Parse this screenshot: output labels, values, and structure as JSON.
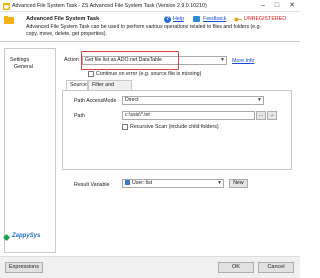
{
  "window": {
    "title": "Advanced File System Task - ZS Advanced File System Task (Version 2.9.0.10210)",
    "minimize_icon": "minimize-icon",
    "maximize_icon": "maximize-icon",
    "close_icon": "close-icon"
  },
  "header": {
    "title": "Advanced File System Task",
    "description": "Advanced File System Task can be used to perform various operations related to files and folders (e.g. copy, move, delete, get properties).",
    "help_label": "Help",
    "feedback_label": "Feedback",
    "unregistered_label": "UNREGISTERED"
  },
  "nav": {
    "items": [
      {
        "label": "Settings"
      },
      {
        "label": "General"
      }
    ],
    "logo_text": "ZappySys"
  },
  "form": {
    "action_label": "Action",
    "action_value": "Get file list as ADO.net DataTable",
    "more_info_label": "More Info",
    "continue_on_error_label": "Continue on error (e.g. source file is missing)",
    "tabs": [
      {
        "label": "Source"
      },
      {
        "label": "Filter and Sorting"
      }
    ],
    "path_access_mode_label": "Path AccessMode",
    "path_access_mode_value": "Direct",
    "path_label": "Path",
    "path_value": "c:\\ssis\\*.txt",
    "browse_label": "...",
    "recursive_scan_label": "Recursive Scan (include child folders)",
    "result_variable_label": "Result Variable",
    "result_variable_value": "User::list",
    "new_button_label": "New"
  },
  "footer": {
    "expressions_label": "Expressions",
    "ok_label": "OK",
    "cancel_label": "Cancel"
  },
  "colors": {
    "accent": "#1a4fd6",
    "unregistered": "#d42020",
    "highlight_border": "#e04040"
  }
}
